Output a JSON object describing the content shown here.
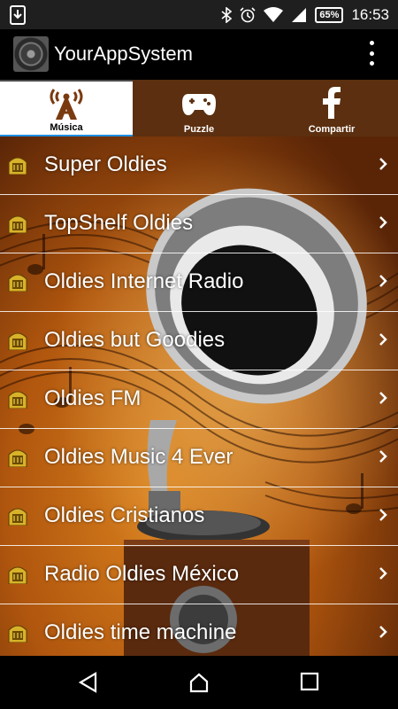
{
  "status_bar": {
    "battery": "65%",
    "time": "16:53"
  },
  "app_bar": {
    "title": "YourAppSystem"
  },
  "tabs": [
    {
      "label": "Música",
      "icon": "radio-tower-icon",
      "active": true
    },
    {
      "label": "Puzzle",
      "icon": "gamepad-icon",
      "active": false
    },
    {
      "label": "Compartir",
      "icon": "facebook-icon",
      "active": false
    }
  ],
  "stations": [
    {
      "label": "Super Oldies"
    },
    {
      "label": "TopShelf Oldies"
    },
    {
      "label": "Oldies Internet Radio"
    },
    {
      "label": "Oldies but Goodies"
    },
    {
      "label": "Oldies FM"
    },
    {
      "label": "Oldies Music 4 Ever"
    },
    {
      "label": "Oldies Cristianos"
    },
    {
      "label": "Radio Oldies México"
    },
    {
      "label": "Oldies time machine"
    }
  ],
  "colors": {
    "accent": "#1e8fe0",
    "tab_inactive": "#5b2f0f",
    "background": "#b0560e"
  }
}
